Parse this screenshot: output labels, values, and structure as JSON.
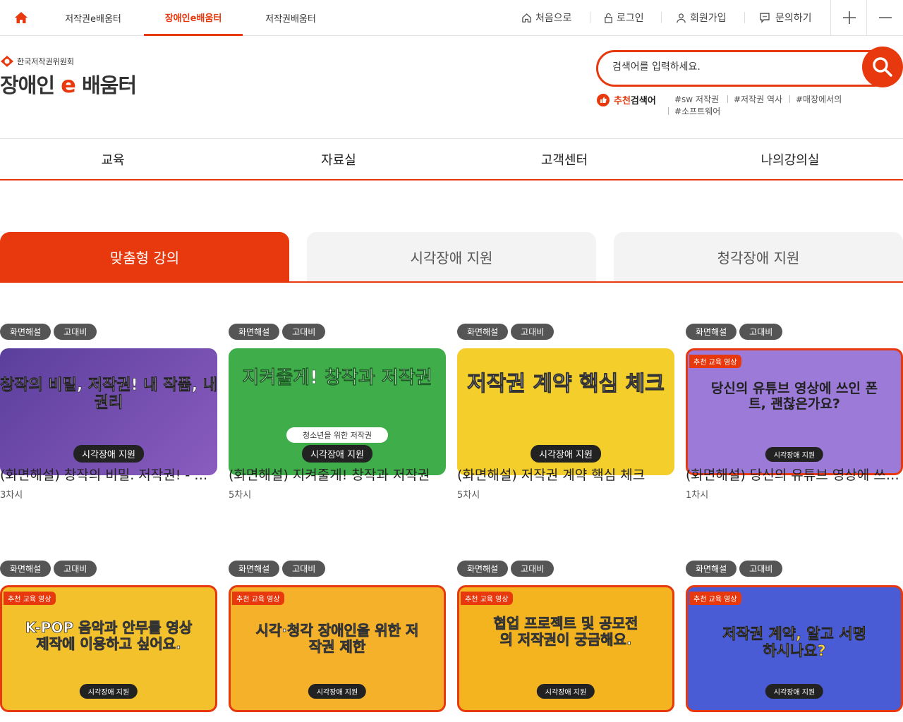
{
  "top": {
    "site_tabs": [
      "저작권e배움터",
      "장애인e배움터",
      "저작권배움터"
    ],
    "utils": [
      "처음으로",
      "로그인",
      "회원가입",
      "문의하기"
    ]
  },
  "logo": {
    "org": "한국저작권위원회",
    "main_a": "장애인",
    "main_e": "e",
    "main_b": "배움터"
  },
  "search": {
    "placeholder": "검색어를 입력하세요.",
    "rec_label_a": "추천",
    "rec_label_b": "검색어",
    "keywords": [
      "#sw 저작권",
      "#저작권 역사",
      "#매장에서의",
      "#소프트웨어"
    ]
  },
  "gnb": [
    "교육",
    "자료실",
    "고객센터",
    "나의강의실"
  ],
  "content_tabs": [
    "맞춤형 강의",
    "시각장애 지원",
    "청각장애 지원"
  ],
  "cards": [
    {
      "badges": [
        "화면해설",
        "고대비"
      ],
      "thumb_text": "창작의 비밀, 저작권! 내 작품, 내 권리",
      "thumb_label": "시각장애 지원",
      "title": "(화면해설) 창작의 비밀. 저작권! - 내 작품, 내 권리",
      "sessions": "3차시",
      "color": "#6a4fa8"
    },
    {
      "badges": [
        "화면해설",
        "고대비"
      ],
      "thumb_text": "지켜줄게! 창작과 저작권",
      "thumb_sub": "청소년을 위한 저작권",
      "thumb_label": "시각장애 지원",
      "title": "(화면해설) 지켜줄게! 창작과 저작권",
      "sessions": "5차시",
      "color": "#3fae4a"
    },
    {
      "badges": [
        "화면해설",
        "고대비"
      ],
      "thumb_text": "저작권 계약 핵심 체크",
      "thumb_label": "시각장애 지원",
      "title": "(화면해설) 저작권 계약 핵심 체크",
      "sessions": "5차시",
      "color": "#f4cf2b"
    },
    {
      "badges": [
        "화면해설",
        "고대비"
      ],
      "thumb_text": "당신의 유튜브 영상에 쓰인 폰트, 괜찮은가요?",
      "thumb_tag": "추천 교육 영상",
      "thumb_label": "시각장애 지원",
      "title": "(화면해설) 당신의 유튜브 영상에 쓰인 폰트, 괜찮은가요?",
      "sessions": "1차시",
      "color": "#9b7ad8"
    },
    {
      "badges": [
        "화면해설",
        "고대비"
      ],
      "thumb_text": "K-POP 음악과 안무를 영상 제작에 이용하고 싶어요.",
      "thumb_tag": "추천 교육 영상",
      "thumb_label": "시각장애 지원",
      "color": "#f3c12b"
    },
    {
      "badges": [
        "화면해설",
        "고대비"
      ],
      "thumb_text": "시각·청각 장애인을 위한 저작권 제한",
      "thumb_tag": "추천 교육 영상",
      "thumb_label": "시각장애 지원",
      "color": "#f5b12a"
    },
    {
      "badges": [
        "화면해설",
        "고대비"
      ],
      "thumb_text": "협업 프로젝트 및 공모전의 저작권이 궁금해요.",
      "thumb_tag": "추천 교육 영상",
      "thumb_label": "시각장애 지원",
      "color": "#f4b41f"
    },
    {
      "badges": [
        "화면해설",
        "고대비"
      ],
      "thumb_text": "저작권 계약, 알고 서명하시나요?",
      "thumb_tag": "추천 교육 영상",
      "thumb_label": "시각장애 지원",
      "color": "#4a5bd6"
    }
  ]
}
